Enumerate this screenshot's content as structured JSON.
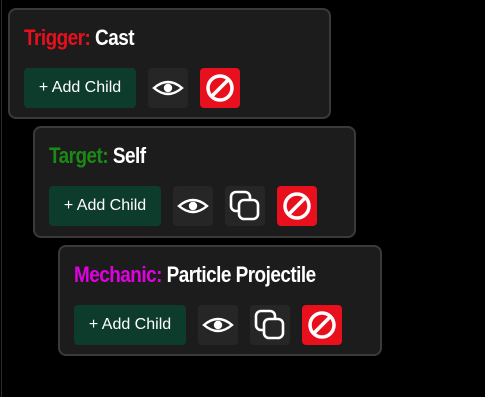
{
  "colors": {
    "trigger": "#e8101c",
    "target": "#1a8a16",
    "mechanic": "#e000e0",
    "add_button_bg": "#0d3b2c",
    "delete_bg": "#e8101c",
    "card_bg": "#1c1c1c"
  },
  "cards": [
    {
      "type_label": "Trigger:",
      "name": "Cast",
      "add_child_label": "+ Add Child",
      "icons": [
        "eye-icon",
        "delete-icon"
      ]
    },
    {
      "type_label": "Target:",
      "name": "Self",
      "add_child_label": "+ Add Child",
      "icons": [
        "eye-icon",
        "duplicate-icon",
        "delete-icon"
      ]
    },
    {
      "type_label": "Mechanic:",
      "name": "Particle Projectile",
      "add_child_label": "+ Add Child",
      "icons": [
        "eye-icon",
        "duplicate-icon",
        "delete-icon"
      ]
    }
  ]
}
